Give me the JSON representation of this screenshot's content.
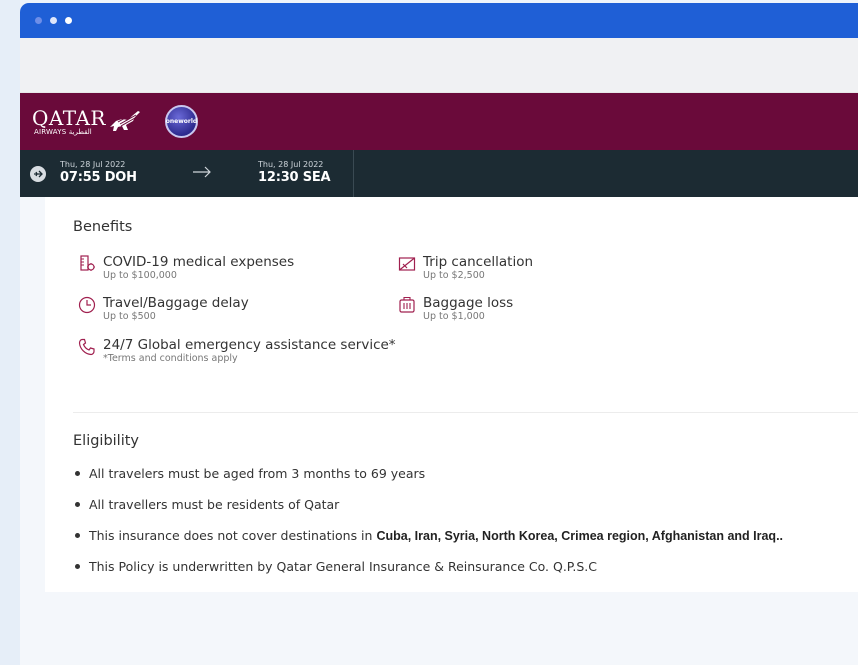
{
  "window": {
    "traffic_lights": [
      "red",
      "yellow",
      "green"
    ]
  },
  "brand": {
    "airline_word": "QATAR",
    "airline_sub": "AIRWAYS القطرية",
    "alliance": "oneworld",
    "colors": {
      "brand_bar": "#6a0a3a",
      "flight_bar": "#1c2b33",
      "icon_accent": "#a0204f"
    }
  },
  "flight": {
    "departure": {
      "date": "Thu, 28 Jul 2022",
      "time_airport": "07:55 DOH"
    },
    "arrival": {
      "date": "Thu, 28 Jul 2022",
      "time_airport": "12:30 SEA"
    }
  },
  "benefits": {
    "title": "Benefits",
    "items": [
      {
        "icon": "covid-icon",
        "name": "COVID-19 medical expenses",
        "limit": "Up to $100,000"
      },
      {
        "icon": "trip-cancel-icon",
        "name": "Trip cancellation",
        "limit": "Up to $2,500"
      },
      {
        "icon": "clock-icon",
        "name": "Travel/Baggage delay",
        "limit": "Up to $500"
      },
      {
        "icon": "baggage-icon",
        "name": "Baggage loss",
        "limit": "Up to $1,000"
      },
      {
        "icon": "phone-icon",
        "name": "24/7 Global emergency assistance service*",
        "limit": "*Terms and conditions apply"
      }
    ]
  },
  "eligibility": {
    "title": "Eligibility",
    "items": [
      "All travelers must be aged from 3 months to 69 years",
      "All travellers must be residents of Qatar",
      "This insurance does not cover destinations in",
      "This Policy is underwritten by Qatar General Insurance & Reinsurance Co. Q.P.S.C"
    ],
    "excluded_destinations": "Cuba, Iran, Syria, North Korea, Crimea region, Afghanistan and Iraq.."
  }
}
